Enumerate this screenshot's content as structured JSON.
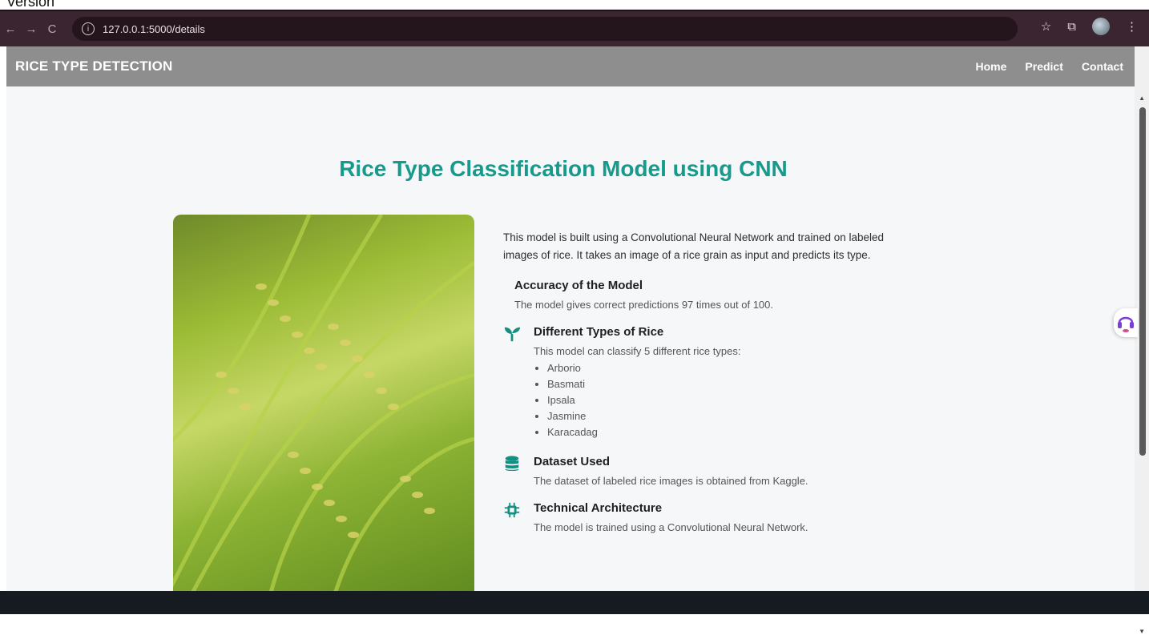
{
  "top_strip": {
    "text": "Version"
  },
  "browser": {
    "back": "←",
    "forward": "→",
    "reload": "C",
    "url": "127.0.0.1:5000/details",
    "star": "☆",
    "extensions": "⧉",
    "menu": "⋮"
  },
  "navbar": {
    "brand": "RICE TYPE DETECTION",
    "links": [
      "Home",
      "Predict",
      "Contact"
    ]
  },
  "main": {
    "title": "Rice Type Classification Model using CNN",
    "intro_line1": "This model is built using a Convolutional Neural Network and trained on labeled",
    "intro_line2": "images of rice. It takes an image of a rice grain as input and predicts its type.",
    "sections": [
      {
        "heading": "Accuracy of the Model",
        "text": "The model gives correct predictions 97 times out of 100."
      },
      {
        "heading": "Different Types of Rice",
        "text": "This model can classify 5 different rice types:",
        "icon": "sprout-icon"
      },
      {
        "heading": "Dataset Used",
        "text": "The dataset of labeled rice images is obtained from Kaggle.",
        "icon": "database-icon"
      },
      {
        "heading": "Technical Architecture",
        "text": "The model is trained using a Convolutional Neural Network.",
        "icon": "chip-icon"
      }
    ],
    "rice_types": [
      "Arborio",
      "Basmati",
      "Ipsala",
      "Jasmine",
      "Karacadag"
    ]
  },
  "colors": {
    "title": "#159a8c",
    "navbar": "#8e8e8e",
    "icon": "#138f82"
  }
}
